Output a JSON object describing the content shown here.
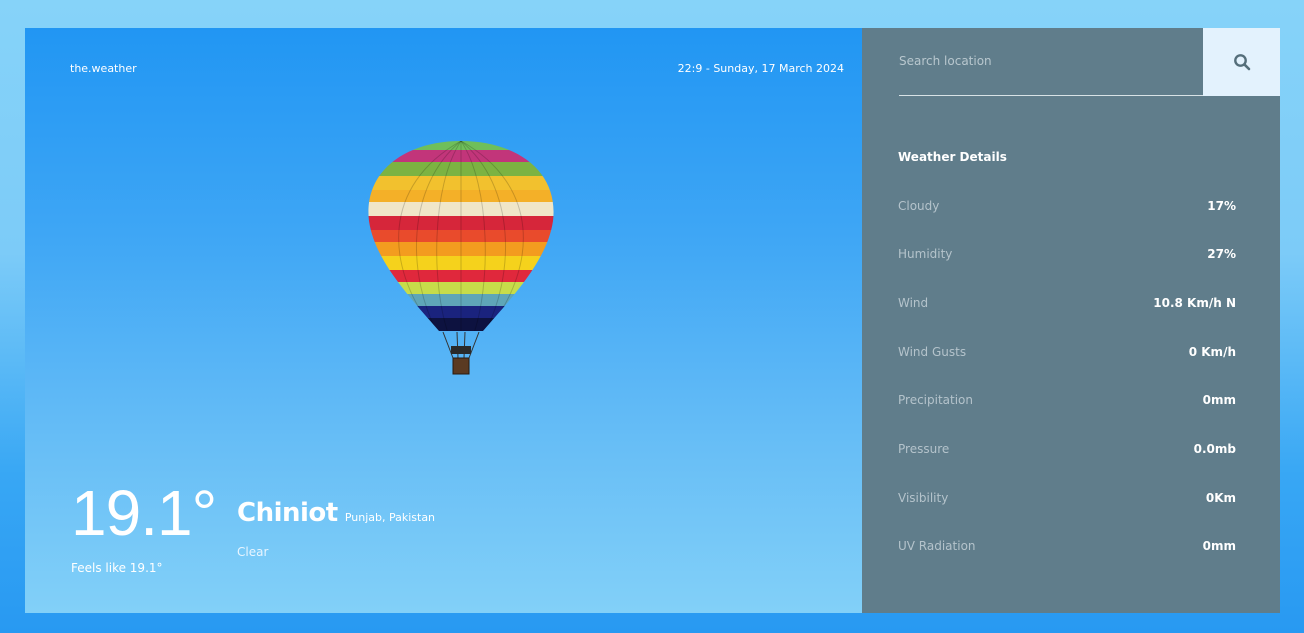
{
  "header": {
    "brand": "the.weather",
    "datetime": "22:9 - Sunday, 17 March 2024"
  },
  "current": {
    "temperature": "19.1°",
    "city": "Chiniot",
    "region": "Punjab, Pakistan",
    "condition": "Clear",
    "feels_like": "Feels like 19.1°"
  },
  "search": {
    "placeholder": "Search location",
    "icon": "search-icon"
  },
  "details": {
    "title": "Weather Details",
    "rows": [
      {
        "label": "Cloudy",
        "value": "17%"
      },
      {
        "label": "Humidity",
        "value": "27%"
      },
      {
        "label": "Wind",
        "value": "10.8 Km/h N"
      },
      {
        "label": "Wind Gusts",
        "value": "0 Km/h"
      },
      {
        "label": "Precipitation",
        "value": "0mm"
      },
      {
        "label": "Pressure",
        "value": "0.0mb"
      },
      {
        "label": "Visibility",
        "value": "0Km"
      },
      {
        "label": "UV Radiation",
        "value": "0mm"
      }
    ]
  },
  "colors": {
    "panel": "#607d8b",
    "sky_top": "#2196f3",
    "sky_bottom": "#82d0f8",
    "search_button": "#e3f2fd"
  }
}
